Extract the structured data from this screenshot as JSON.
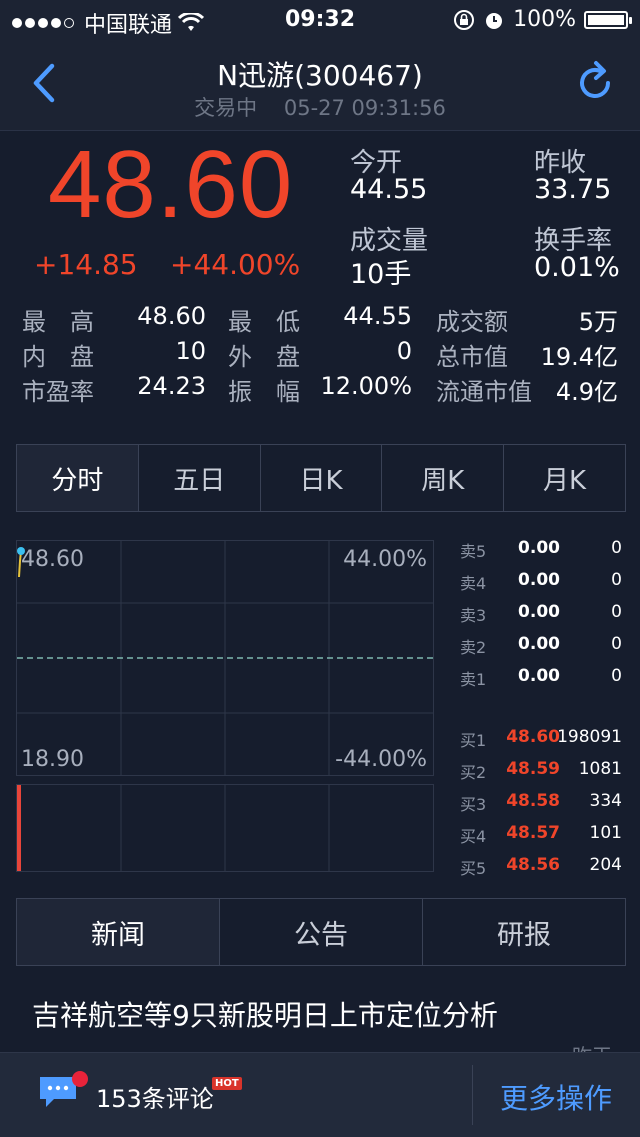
{
  "status_bar": {
    "carrier": "中国联通",
    "time": "09:32",
    "battery": "100%"
  },
  "nav": {
    "title": "N迅游(300467)",
    "status": "交易中",
    "datetime": "05-27 09:31:56"
  },
  "quote": {
    "price": "48.60",
    "change": "+14.85",
    "change_pct": "+44.00%",
    "open_label": "今开",
    "open": "44.55",
    "prev_close_label": "昨收",
    "prev_close": "33.75",
    "volume_label": "成交量",
    "volume": "10手",
    "turnover_label": "换手率",
    "turnover": "0.01%"
  },
  "stats": {
    "high_label": "最　高",
    "high": "48.60",
    "low_label": "最　低",
    "low": "44.55",
    "amount_label": "成交额",
    "amount": "5万",
    "inner_label": "内　盘",
    "inner": "10",
    "outer_label": "外　盘",
    "outer": "0",
    "mktcap_label": "总市值",
    "mktcap": "19.4亿",
    "pe_label": "市盈率",
    "pe": "24.23",
    "amplitude_label": "振　幅",
    "amplitude": "12.00%",
    "float_label": "流通市值",
    "float_cap": "4.9亿"
  },
  "tabs": [
    "分时",
    "五日",
    "日K",
    "周K",
    "月K"
  ],
  "chart": {
    "price_high": "48.60",
    "price_low": "18.90",
    "pct_high": "44.00%",
    "pct_low": "-44.00%"
  },
  "order_book": {
    "asks": [
      {
        "label": "卖5",
        "price": "0.00",
        "volume": "0"
      },
      {
        "label": "卖4",
        "price": "0.00",
        "volume": "0"
      },
      {
        "label": "卖3",
        "price": "0.00",
        "volume": "0"
      },
      {
        "label": "卖2",
        "price": "0.00",
        "volume": "0"
      },
      {
        "label": "卖1",
        "price": "0.00",
        "volume": "0"
      }
    ],
    "bids": [
      {
        "label": "买1",
        "price": "48.60",
        "volume": "198091"
      },
      {
        "label": "买2",
        "price": "48.59",
        "volume": "1081"
      },
      {
        "label": "买3",
        "price": "48.58",
        "volume": "334"
      },
      {
        "label": "买4",
        "price": "48.57",
        "volume": "101"
      },
      {
        "label": "买5",
        "price": "48.56",
        "volume": "204"
      }
    ]
  },
  "news_tabs": [
    "新闻",
    "公告",
    "研报"
  ],
  "news": {
    "headline": "吉祥航空等9只新股明日上市定位分析",
    "time": "昨天"
  },
  "bottom": {
    "comments": "153条评论",
    "hot_badge": "HOT",
    "more": "更多操作"
  },
  "colors": {
    "up": "#f0452a",
    "accent": "#4e9bff",
    "background": "#161d2d"
  }
}
